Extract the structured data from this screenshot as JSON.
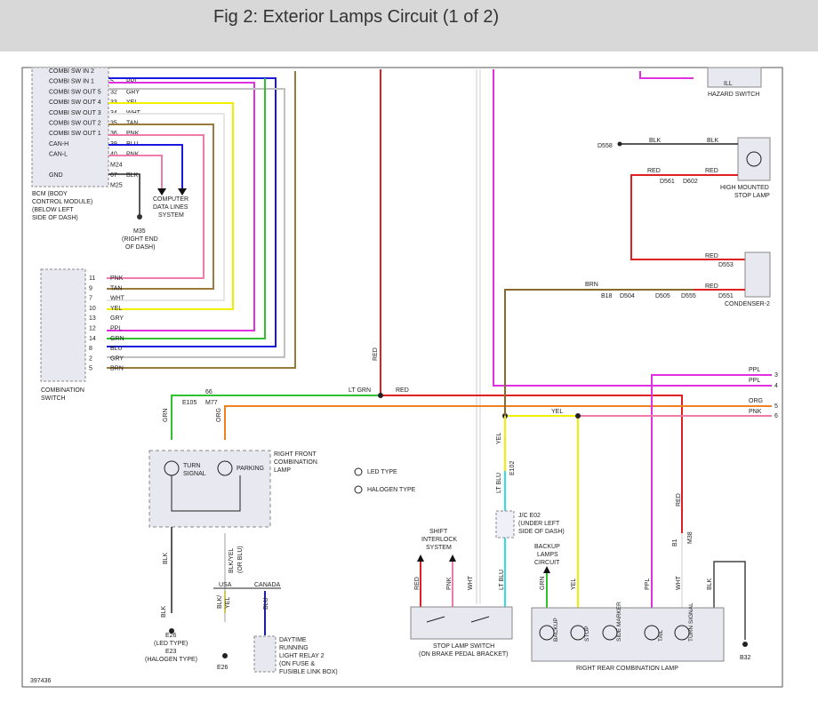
{
  "header": {
    "title": "Fig 2: Exterior Lamps Circuit (1 of 2)"
  },
  "diagram_id": "397436",
  "colors": {
    "red": "#e02020",
    "pink": "#f07aa8",
    "purple": "#e030e0",
    "yellow": "#f0f000",
    "green": "#30c030",
    "blue": "#1818e0",
    "gray": "#c0c0c0",
    "white": "#e6e6e6",
    "tan": "#9a7a3a",
    "orange": "#f08020",
    "black": "#222222",
    "cyan": "#30e0e0",
    "brown": "#8a6a2a",
    "box": "#e8e8f0"
  },
  "bcm": {
    "pins": [
      {
        "name": "COMBI SW IN 2",
        "pin": "",
        "wire": ""
      },
      {
        "name": "COMBI SW IN 1",
        "pin": "5",
        "wire": "PPL"
      },
      {
        "name": "COMBI SW OUT 5",
        "pin": "32",
        "wire": "GRY"
      },
      {
        "name": "COMBI SW OUT 4",
        "pin": "33",
        "wire": "YEL"
      },
      {
        "name": "COMBI SW OUT 3",
        "pin": "34",
        "wire": "WHT"
      },
      {
        "name": "COMBI SW OUT 2",
        "pin": "35",
        "wire": "TAN"
      },
      {
        "name": "COMBI SW OUT 1",
        "pin": "36",
        "wire": "PNK"
      },
      {
        "name": "CAN-H",
        "pin": "39",
        "wire": "BLU"
      },
      {
        "name": "CAN-L",
        "pin": "40",
        "wire": "PNK"
      },
      {
        "name": "",
        "pin": "M24",
        "wire": ""
      },
      {
        "name": "GND",
        "pin": "67",
        "wire": "BLK"
      },
      {
        "name": "",
        "pin": "M25",
        "wire": ""
      }
    ],
    "label": [
      "BCM (BODY",
      "CONTROL MODULE)",
      "(BELOW LEFT",
      "SIDE OF DASH)"
    ],
    "ground_label": [
      "M35",
      "(RIGHT END",
      "OF DASH)"
    ],
    "computer_label": [
      "COMPUTER",
      "DATA LINES",
      "SYSTEM"
    ]
  },
  "combo_switch": {
    "pins": [
      {
        "pin": "11",
        "wire": "PNK"
      },
      {
        "pin": "9",
        "wire": "TAN"
      },
      {
        "pin": "7",
        "wire": "WHT"
      },
      {
        "pin": "10",
        "wire": "YEL"
      },
      {
        "pin": "13",
        "wire": "GRY"
      },
      {
        "pin": "12",
        "wire": "PPL"
      },
      {
        "pin": "14",
        "wire": "GRN"
      },
      {
        "pin": "8",
        "wire": "BLU"
      },
      {
        "pin": "2",
        "wire": "GRY"
      },
      {
        "pin": "5",
        "wire": "BRN"
      }
    ],
    "label": [
      "COMBINATION",
      "SWITCH"
    ]
  },
  "labels": {
    "hazard": "HAZARD SWITCH",
    "ill": "ILL",
    "d558": "D558",
    "blk": "BLK",
    "red": "RED",
    "d561": "D561",
    "d602": "D602",
    "hmsl": [
      "HIGH MOUNTED",
      "STOP LAMP"
    ],
    "d553": "D553",
    "brn": "BRN",
    "b18": "B18",
    "d504": "D504",
    "d505": "D505",
    "d555": "D555",
    "d551": "D551",
    "condenser": "CONDENSER-2",
    "ppl": "PPL",
    "org": "ORG",
    "pnk": "PNK",
    "yel": "YEL",
    "grn": "GRN",
    "ltgrn": "LT GRN",
    "ltblu": "LT BLU",
    "wht": "WHT",
    "e105": "E105",
    "m77": "M77",
    "p66": "66",
    "rf_lamp": [
      "RIGHT FRONT",
      "COMBINATION",
      "LAMP"
    ],
    "turn_signal": [
      "TURN",
      "SIGNAL"
    ],
    "parking": "PARKING",
    "led_type": "LED TYPE",
    "halogen_type": "HALOGEN TYPE",
    "e102": "E102",
    "jc": [
      "J/C E02",
      "(UNDER LEFT",
      "SIDE OF DASH)"
    ],
    "m38": "M38",
    "b1": "B1",
    "shift": [
      "SHIFT",
      "INTERLOCK",
      "SYSTEM"
    ],
    "backup_circ": [
      "BACKUP",
      "LAMPS",
      "CIRCUIT"
    ],
    "usa": "USA",
    "canada": "CANADA",
    "blkyel": "BLK/YEL",
    "orblu": "(OR BLU)",
    "blu": "BLU",
    "e26": "E26",
    "e26_led": "(LED TYPE)",
    "e23": "E23",
    "e23_hal": "(HALOGEN TYPE)",
    "e26b": "E26",
    "drl": [
      "DAYTIME",
      "RUNNING",
      "LIGHT RELAY 2",
      "(ON FUSE &",
      "FUSIBLE LINK BOX)"
    ],
    "stop_sw": [
      "STOP LAMP SWITCH",
      "(ON BRAKE PEDAL BRACKET)"
    ],
    "rr_lamp": "RIGHT REAR COMBINATION LAMP",
    "b32": "B32",
    "rr_items": [
      "BACKUP",
      "STOP",
      "SIDE MARKER",
      "TAIL",
      "TURN SIGNAL"
    ],
    "blk_yel": [
      "BLK/",
      "YEL"
    ]
  }
}
